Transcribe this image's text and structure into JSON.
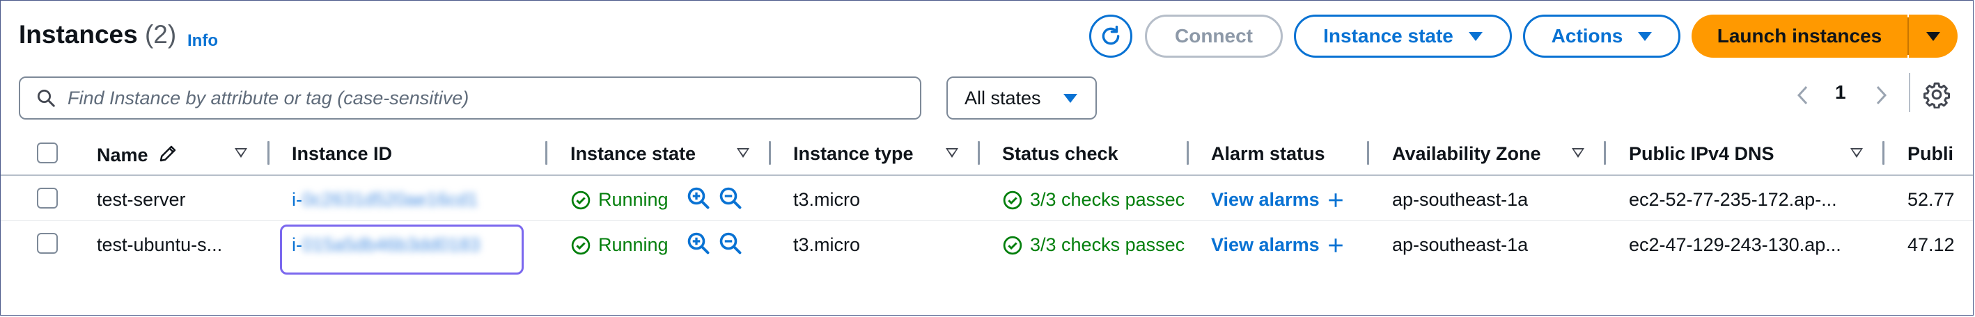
{
  "header": {
    "title": "Instances",
    "count": "(2)",
    "info_label": "Info"
  },
  "toolbar": {
    "refresh_icon": "refresh-icon",
    "connect_label": "Connect",
    "instance_state_label": "Instance state",
    "actions_label": "Actions",
    "launch_label": "Launch instances"
  },
  "filter": {
    "search_placeholder": "Find Instance by attribute or tag (case-sensitive)",
    "states_value": "All states"
  },
  "pagination": {
    "current_page": "1"
  },
  "table": {
    "columns": [
      "Name",
      "Instance ID",
      "Instance state",
      "Instance type",
      "Status check",
      "Alarm status",
      "Availability Zone",
      "Public IPv4 DNS",
      "Publi"
    ],
    "rows": [
      {
        "name": "test-server",
        "id_prefix": "i-",
        "id_redacted": "0c2631d520ae16cd1",
        "state": "Running",
        "type": "t3.micro",
        "status_check": "3/3 checks passec",
        "alarm": "View alarms",
        "az": "ap-southeast-1a",
        "dns": "ec2-52-77-235-172.ap-...",
        "public_ip": "52.77"
      },
      {
        "name": "test-ubuntu-s...",
        "id_prefix": "i-",
        "id_redacted": "015a5db46b3dd0183",
        "state": "Running",
        "type": "t3.micro",
        "status_check": "3/3 checks passec",
        "alarm": "View alarms",
        "az": "ap-southeast-1a",
        "dns": "ec2-47-129-243-130.ap...",
        "public_ip": "47.12"
      }
    ]
  },
  "colors": {
    "primary": "#ff9900",
    "link": "#0972d3",
    "success": "#037f0c",
    "focus": "#7b68ee"
  }
}
